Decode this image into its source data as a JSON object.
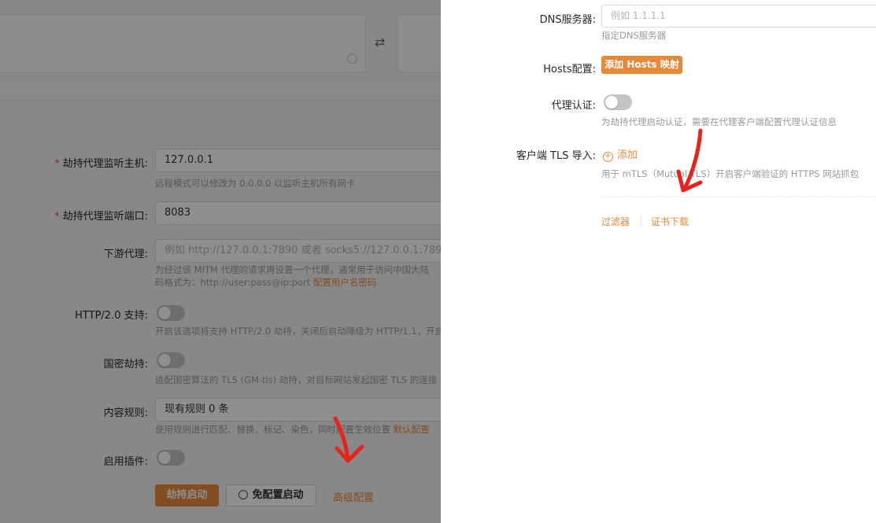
{
  "left_form": {
    "host": {
      "label": "劫持代理监听主机:",
      "required_mark": "*",
      "value": "127.0.0.1",
      "hint": "远程模式可以修改为 0.0.0.0 以监听主机所有网卡"
    },
    "port": {
      "label": "劫持代理监听端口:",
      "required_mark": "*",
      "value": "8083"
    },
    "downstream": {
      "label": "下游代理:",
      "placeholder": "例如 http://127.0.0.1:7890 或者 socks5://127.0.0.1:7890",
      "hint_line1": "为经过该 MITM 代理的请求再设置一个代理，通常用于访问中国大陆",
      "hint_line2": "码格式为：http://user:pass@ip:port",
      "hint_link": "配置用户名密码"
    },
    "http2": {
      "label": "HTTP/2.0 支持:",
      "hint": "开启该选项将支持 HTTP/2.0 劫持，关闭后自动降级为 HTTP/1.1，开启"
    },
    "gm": {
      "label": "国密劫持:",
      "hint": "适配国密算法的 TLS (GM-tls) 劫持，对目标网站发起国密 TLS 的连接"
    },
    "rules": {
      "label": "内容规则:",
      "value": "现有规则 0 条",
      "hint": "使用规则进行匹配、替换、标记、染色，同时配置生效位置",
      "hint_link": "默认配置"
    },
    "plugins": {
      "label": "启用插件:"
    },
    "buttons": {
      "start": "劫持启动",
      "no_config_start": "免配置启动",
      "advanced": "高级配置"
    }
  },
  "drawer": {
    "dns": {
      "label": "DNS服务器:",
      "placeholder": "例如 1.1.1.1",
      "hint": "指定DNS服务器"
    },
    "hosts": {
      "label": "Hosts配置:",
      "button": "添加 Hosts 映射"
    },
    "proxy_auth": {
      "label": "代理认证:",
      "hint": "为劫持代理启动认证，需要在代理客户端配置代理认证信息"
    },
    "client_tls": {
      "label": "客户端 TLS 导入:",
      "add": "添加",
      "hint": "用于 mTLS（Mutual TLS）开启客户端验证的 HTTPS 网站抓包"
    },
    "tabs": {
      "filter": "过滤器",
      "cert_download": "证书下载"
    }
  },
  "colors": {
    "accent": "#e8893a",
    "annotation_arrow": "#e8231b",
    "overlay": "rgba(0,0,0,0.44)"
  }
}
